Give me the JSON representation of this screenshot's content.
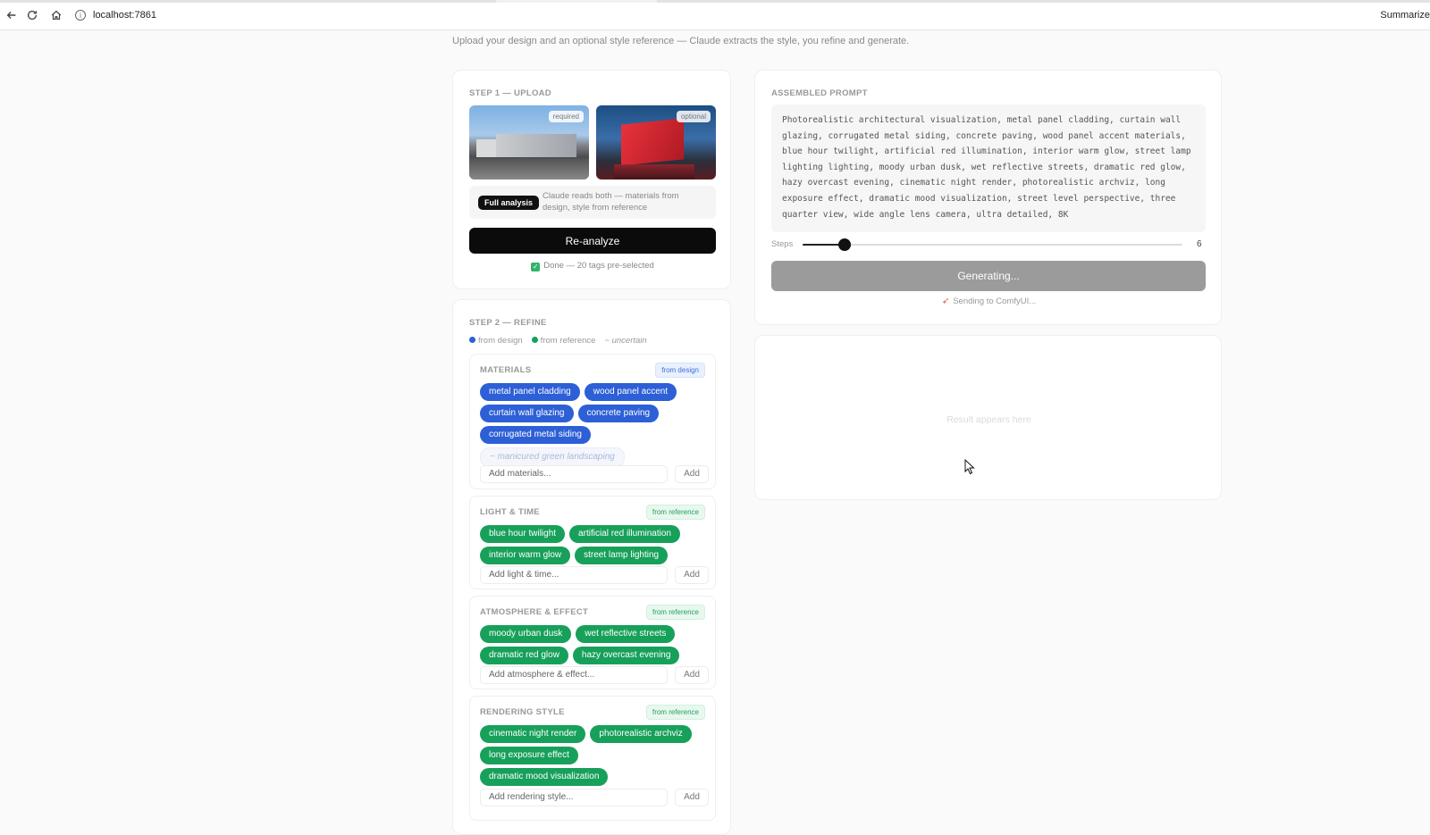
{
  "browser": {
    "url": "localhost:7861",
    "right_label": "Summarize"
  },
  "page": {
    "subtitle": "Upload your design and an optional style reference — Claude extracts the style, you refine and generate."
  },
  "step1": {
    "label": "STEP 1 — UPLOAD",
    "design_pill": "required",
    "reference_pill": "optional",
    "analysis_badge": "Full analysis",
    "analysis_text": "Claude reads both — materials from design, style from reference",
    "reanalyze_label": "Re-analyze",
    "status": "Done — 20 tags pre-selected"
  },
  "step2": {
    "label": "STEP 2 — REFINE",
    "legend": {
      "design": "from design",
      "reference": "from reference",
      "uncertain": "~ uncertain"
    },
    "groups": [
      {
        "title": "MATERIALS",
        "source": "from design",
        "tags": [
          "metal panel cladding",
          "wood panel accent",
          "curtain wall glazing",
          "concrete paving",
          "corrugated metal siding"
        ],
        "uncertain": "~ manicured green landscaping",
        "placeholder": "Add materials...",
        "add": "Add"
      },
      {
        "title": "LIGHT & TIME",
        "source": "from reference",
        "tags": [
          "blue hour twilight",
          "artificial red illumination",
          "interior warm glow",
          "street lamp lighting"
        ],
        "placeholder": "Add light & time...",
        "add": "Add"
      },
      {
        "title": "ATMOSPHERE & EFFECT",
        "source": "from reference",
        "tags": [
          "moody urban dusk",
          "wet reflective streets",
          "dramatic red glow",
          "hazy overcast evening"
        ],
        "placeholder": "Add atmosphere & effect...",
        "add": "Add"
      },
      {
        "title": "RENDERING STYLE",
        "source": "from reference",
        "tags": [
          "cinematic night render",
          "photorealistic archviz",
          "long exposure effect",
          "dramatic mood visualization"
        ],
        "placeholder": "Add rendering style...",
        "add": "Add"
      }
    ]
  },
  "prompt": {
    "label": "ASSEMBLED PROMPT",
    "text": "Photorealistic architectural visualization, metal panel cladding, curtain wall glazing, corrugated metal siding, concrete paving, wood panel accent materials, blue hour twilight, artificial red illumination, interior warm glow, street lamp lighting lighting, moody urban dusk, wet reflective streets, dramatic red glow, hazy overcast evening, cinematic night render, photorealistic archviz, long exposure effect, dramatic mood visualization, street level perspective, three quarter view, wide angle lens camera, ultra detailed, 8K",
    "steps_label": "Steps",
    "steps_value": "6",
    "steps_fraction": 0.11,
    "generate_label": "Generating...",
    "status": "Sending to ComfyUI..."
  },
  "result": {
    "placeholder": "Result appears here"
  },
  "colors": {
    "design_tag": "#2d5fd6",
    "reference_tag": "#17a05a",
    "primary_button": "#0b0b0b",
    "disabled_button": "#9b9b9b"
  }
}
